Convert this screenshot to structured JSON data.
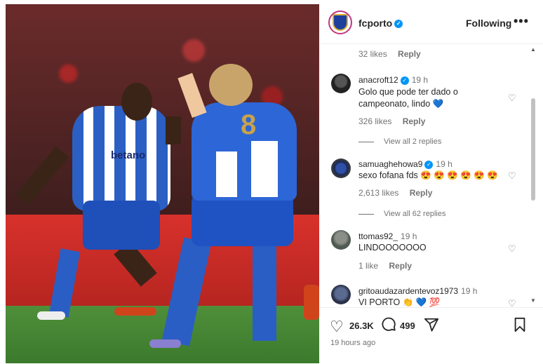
{
  "post": {
    "username": "fcporto",
    "follow_label": "Following",
    "more_label": "•••",
    "sponsor_text": "betano",
    "jersey_number": "8"
  },
  "comments": [
    {
      "type": "meta",
      "likes": "32 likes",
      "reply": "Reply"
    },
    {
      "username": "anacroft12",
      "verified": true,
      "time": "19 h",
      "text": "Golo que pode ter dado o campeonato, lindo 💙",
      "likes": "326 likes",
      "reply": "Reply",
      "view_replies": "View all 2 replies"
    },
    {
      "username": "samuaghehowa9",
      "verified": true,
      "time": "19 h",
      "text": "sexo fofana fds 😍 😍 😍 😍 😍 😍",
      "likes": "2,613 likes",
      "reply": "Reply",
      "view_replies": "View all 62 replies"
    },
    {
      "username": "ttomas92_",
      "verified": false,
      "time": "19 h",
      "text": "LINDOOOOOOO",
      "likes": "1 like",
      "reply": "Reply"
    },
    {
      "username": "gritoaudazardentevoz1973",
      "verified": false,
      "time": "19 h",
      "text": "VI PORTO 👏 💙 💯"
    }
  ],
  "actions": {
    "likes": "26.3K",
    "comments": "499",
    "posted": "19 hours ago"
  },
  "icons": {
    "verified": "verified-badge-icon",
    "heart": "heart-icon",
    "comment": "comment-icon",
    "share": "share-icon",
    "save": "bookmark-icon"
  },
  "colors": {
    "verified": "#0095f6",
    "muted": "#737373",
    "text": "#262626"
  }
}
